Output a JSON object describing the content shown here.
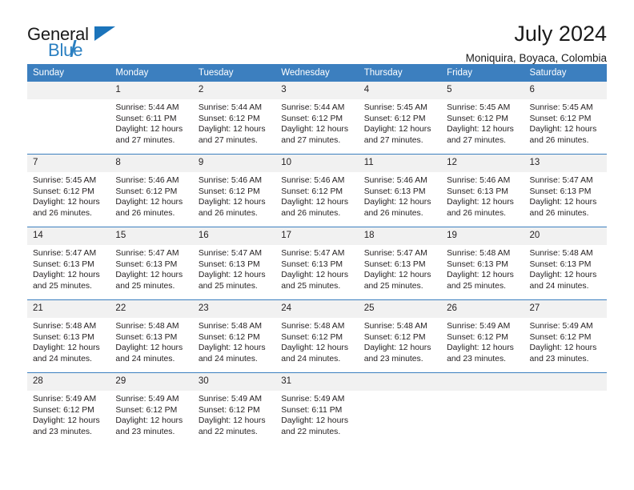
{
  "brand": {
    "name_part1": "General",
    "name_part2": "Blue"
  },
  "header": {
    "title": "July 2024",
    "subtitle": "Moniquira, Boyaca, Colombia"
  },
  "calendar": {
    "weekday_headers": [
      "Sunday",
      "Monday",
      "Tuesday",
      "Wednesday",
      "Thursday",
      "Friday",
      "Saturday"
    ],
    "accent_color": "#3c7fbf",
    "daynum_bg": "#f1f1f1",
    "labels": {
      "sunrise": "Sunrise:",
      "sunset": "Sunset:",
      "daylight": "Daylight:"
    },
    "weeks": [
      [
        {
          "day": "",
          "sunrise": "",
          "sunset": "",
          "daylight_line1": "",
          "daylight_line2": ""
        },
        {
          "day": "1",
          "sunrise": "Sunrise: 5:44 AM",
          "sunset": "Sunset: 6:11 PM",
          "daylight_line1": "Daylight: 12 hours",
          "daylight_line2": "and 27 minutes."
        },
        {
          "day": "2",
          "sunrise": "Sunrise: 5:44 AM",
          "sunset": "Sunset: 6:12 PM",
          "daylight_line1": "Daylight: 12 hours",
          "daylight_line2": "and 27 minutes."
        },
        {
          "day": "3",
          "sunrise": "Sunrise: 5:44 AM",
          "sunset": "Sunset: 6:12 PM",
          "daylight_line1": "Daylight: 12 hours",
          "daylight_line2": "and 27 minutes."
        },
        {
          "day": "4",
          "sunrise": "Sunrise: 5:45 AM",
          "sunset": "Sunset: 6:12 PM",
          "daylight_line1": "Daylight: 12 hours",
          "daylight_line2": "and 27 minutes."
        },
        {
          "day": "5",
          "sunrise": "Sunrise: 5:45 AM",
          "sunset": "Sunset: 6:12 PM",
          "daylight_line1": "Daylight: 12 hours",
          "daylight_line2": "and 27 minutes."
        },
        {
          "day": "6",
          "sunrise": "Sunrise: 5:45 AM",
          "sunset": "Sunset: 6:12 PM",
          "daylight_line1": "Daylight: 12 hours",
          "daylight_line2": "and 26 minutes."
        }
      ],
      [
        {
          "day": "7",
          "sunrise": "Sunrise: 5:45 AM",
          "sunset": "Sunset: 6:12 PM",
          "daylight_line1": "Daylight: 12 hours",
          "daylight_line2": "and 26 minutes."
        },
        {
          "day": "8",
          "sunrise": "Sunrise: 5:46 AM",
          "sunset": "Sunset: 6:12 PM",
          "daylight_line1": "Daylight: 12 hours",
          "daylight_line2": "and 26 minutes."
        },
        {
          "day": "9",
          "sunrise": "Sunrise: 5:46 AM",
          "sunset": "Sunset: 6:12 PM",
          "daylight_line1": "Daylight: 12 hours",
          "daylight_line2": "and 26 minutes."
        },
        {
          "day": "10",
          "sunrise": "Sunrise: 5:46 AM",
          "sunset": "Sunset: 6:12 PM",
          "daylight_line1": "Daylight: 12 hours",
          "daylight_line2": "and 26 minutes."
        },
        {
          "day": "11",
          "sunrise": "Sunrise: 5:46 AM",
          "sunset": "Sunset: 6:13 PM",
          "daylight_line1": "Daylight: 12 hours",
          "daylight_line2": "and 26 minutes."
        },
        {
          "day": "12",
          "sunrise": "Sunrise: 5:46 AM",
          "sunset": "Sunset: 6:13 PM",
          "daylight_line1": "Daylight: 12 hours",
          "daylight_line2": "and 26 minutes."
        },
        {
          "day": "13",
          "sunrise": "Sunrise: 5:47 AM",
          "sunset": "Sunset: 6:13 PM",
          "daylight_line1": "Daylight: 12 hours",
          "daylight_line2": "and 26 minutes."
        }
      ],
      [
        {
          "day": "14",
          "sunrise": "Sunrise: 5:47 AM",
          "sunset": "Sunset: 6:13 PM",
          "daylight_line1": "Daylight: 12 hours",
          "daylight_line2": "and 25 minutes."
        },
        {
          "day": "15",
          "sunrise": "Sunrise: 5:47 AM",
          "sunset": "Sunset: 6:13 PM",
          "daylight_line1": "Daylight: 12 hours",
          "daylight_line2": "and 25 minutes."
        },
        {
          "day": "16",
          "sunrise": "Sunrise: 5:47 AM",
          "sunset": "Sunset: 6:13 PM",
          "daylight_line1": "Daylight: 12 hours",
          "daylight_line2": "and 25 minutes."
        },
        {
          "day": "17",
          "sunrise": "Sunrise: 5:47 AM",
          "sunset": "Sunset: 6:13 PM",
          "daylight_line1": "Daylight: 12 hours",
          "daylight_line2": "and 25 minutes."
        },
        {
          "day": "18",
          "sunrise": "Sunrise: 5:47 AM",
          "sunset": "Sunset: 6:13 PM",
          "daylight_line1": "Daylight: 12 hours",
          "daylight_line2": "and 25 minutes."
        },
        {
          "day": "19",
          "sunrise": "Sunrise: 5:48 AM",
          "sunset": "Sunset: 6:13 PM",
          "daylight_line1": "Daylight: 12 hours",
          "daylight_line2": "and 25 minutes."
        },
        {
          "day": "20",
          "sunrise": "Sunrise: 5:48 AM",
          "sunset": "Sunset: 6:13 PM",
          "daylight_line1": "Daylight: 12 hours",
          "daylight_line2": "and 24 minutes."
        }
      ],
      [
        {
          "day": "21",
          "sunrise": "Sunrise: 5:48 AM",
          "sunset": "Sunset: 6:13 PM",
          "daylight_line1": "Daylight: 12 hours",
          "daylight_line2": "and 24 minutes."
        },
        {
          "day": "22",
          "sunrise": "Sunrise: 5:48 AM",
          "sunset": "Sunset: 6:13 PM",
          "daylight_line1": "Daylight: 12 hours",
          "daylight_line2": "and 24 minutes."
        },
        {
          "day": "23",
          "sunrise": "Sunrise: 5:48 AM",
          "sunset": "Sunset: 6:12 PM",
          "daylight_line1": "Daylight: 12 hours",
          "daylight_line2": "and 24 minutes."
        },
        {
          "day": "24",
          "sunrise": "Sunrise: 5:48 AM",
          "sunset": "Sunset: 6:12 PM",
          "daylight_line1": "Daylight: 12 hours",
          "daylight_line2": "and 24 minutes."
        },
        {
          "day": "25",
          "sunrise": "Sunrise: 5:48 AM",
          "sunset": "Sunset: 6:12 PM",
          "daylight_line1": "Daylight: 12 hours",
          "daylight_line2": "and 23 minutes."
        },
        {
          "day": "26",
          "sunrise": "Sunrise: 5:49 AM",
          "sunset": "Sunset: 6:12 PM",
          "daylight_line1": "Daylight: 12 hours",
          "daylight_line2": "and 23 minutes."
        },
        {
          "day": "27",
          "sunrise": "Sunrise: 5:49 AM",
          "sunset": "Sunset: 6:12 PM",
          "daylight_line1": "Daylight: 12 hours",
          "daylight_line2": "and 23 minutes."
        }
      ],
      [
        {
          "day": "28",
          "sunrise": "Sunrise: 5:49 AM",
          "sunset": "Sunset: 6:12 PM",
          "daylight_line1": "Daylight: 12 hours",
          "daylight_line2": "and 23 minutes."
        },
        {
          "day": "29",
          "sunrise": "Sunrise: 5:49 AM",
          "sunset": "Sunset: 6:12 PM",
          "daylight_line1": "Daylight: 12 hours",
          "daylight_line2": "and 23 minutes."
        },
        {
          "day": "30",
          "sunrise": "Sunrise: 5:49 AM",
          "sunset": "Sunset: 6:12 PM",
          "daylight_line1": "Daylight: 12 hours",
          "daylight_line2": "and 22 minutes."
        },
        {
          "day": "31",
          "sunrise": "Sunrise: 5:49 AM",
          "sunset": "Sunset: 6:11 PM",
          "daylight_line1": "Daylight: 12 hours",
          "daylight_line2": "and 22 minutes."
        },
        {
          "day": "",
          "sunrise": "",
          "sunset": "",
          "daylight_line1": "",
          "daylight_line2": ""
        },
        {
          "day": "",
          "sunrise": "",
          "sunset": "",
          "daylight_line1": "",
          "daylight_line2": ""
        },
        {
          "day": "",
          "sunrise": "",
          "sunset": "",
          "daylight_line1": "",
          "daylight_line2": ""
        }
      ]
    ]
  }
}
